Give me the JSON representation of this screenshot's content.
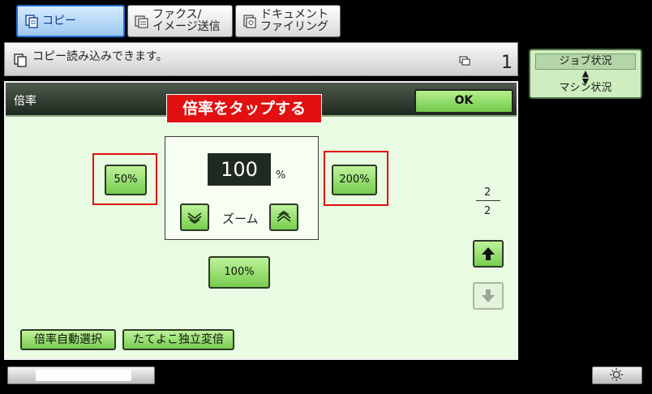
{
  "tabs": [
    {
      "label": "コピー",
      "icon": "copy-icon",
      "active": true
    },
    {
      "label": "ファクス/\nイメージ送信",
      "icon": "fax-icon",
      "active": false
    },
    {
      "label": "ドキュメント\nファイリング",
      "icon": "document-filing-icon",
      "active": false
    }
  ],
  "status": {
    "message": "コピー読み込みできます。",
    "count": "1"
  },
  "job_status": {
    "top_label": "ジョブ状況",
    "arrows": "▲\n▼",
    "bottom_label": "マシン状況"
  },
  "panel": {
    "title": "倍率",
    "ok_label": "OK",
    "callout": "倍率をタップする",
    "preset_50": "50%",
    "preset_200": "200%",
    "preset_100": "100%",
    "zoom_value": "100",
    "zoom_unit": "%",
    "zoom_label": "ズーム",
    "page_current": "2",
    "page_total": "2",
    "auto_ratio_label": "倍率自動選択",
    "xy_zoom_label": "たてよこ独立変倍"
  },
  "colors": {
    "accent_green": "#77cd4f",
    "callout_red": "#e21010",
    "active_tab_blue": "#1f6fd6"
  }
}
